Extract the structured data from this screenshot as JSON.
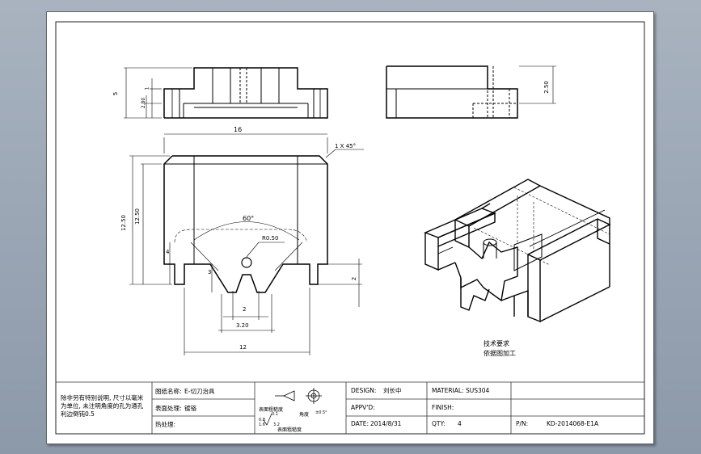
{
  "drawing": {
    "dims": {
      "top_height": "5",
      "top_step": "2.80",
      "top_small": "1",
      "width_total": "16",
      "chamfer": "1 X 45°",
      "height_outer": "12.50",
      "height_inner": "12.50",
      "angle": "60°",
      "radius": "R0.50",
      "slot_left": "4",
      "slot_depth": "3",
      "v_gap": "2",
      "v_span": "3.20",
      "base_width": "12",
      "right_step": "2",
      "side_height": "2.50"
    },
    "tech_title": "技术要求",
    "tech_body": "依据图加工",
    "notes": [
      "除非另有特别说明, 尺寸以毫米",
      "为单位, 未注明角度的孔为通孔",
      "利边倒钝0.5"
    ]
  },
  "titleblock": {
    "name_label": "图纸名称:",
    "name_value": "E-切刀治具",
    "surface_label": "表面处理:",
    "surface_value": "镀铬",
    "heat_label": "热处理:",
    "roughness_title": "表面粗糙度",
    "roughness_label": "表面粗糙度",
    "roughness_values": [
      "0.1",
      "0.8",
      "1.6",
      "3.2"
    ],
    "flatness_label": "角度",
    "flatness_value": "±0.5°",
    "design_label": "DESIGN:",
    "design_value": "刘长中",
    "approved_label": "APPV'D:",
    "date_label": "DATE:",
    "date_value": "2014/8/31",
    "material_label": "MATERIAL:",
    "material_value": "SUS304",
    "finish_label": "FINISH:",
    "qty_label": "QTY:",
    "qty_value": "4",
    "pn_label": "P/N:",
    "pn_value": "KD-2014068-E1A"
  }
}
